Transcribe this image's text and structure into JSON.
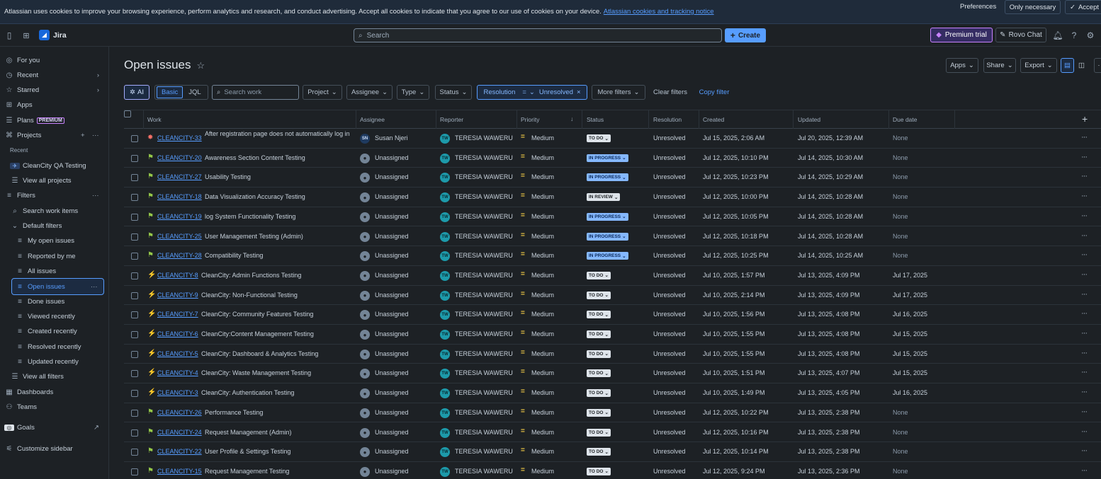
{
  "cookie": {
    "text": "Atlassian uses cookies to improve your browsing experience, perform analytics and research, and conduct advertising. Accept all cookies to indicate that you agree to our use of cookies on your device.",
    "link": "Atlassian cookies and tracking notice",
    "preferences": "Preferences",
    "only_necessary": "Only necessary",
    "accept": "Accept"
  },
  "topnav": {
    "app_name": "Jira",
    "search_placeholder": "Search",
    "create_label": "Create",
    "premium_label": "Premium trial",
    "rovo_label": "Rovo Chat"
  },
  "sidebar": {
    "for_you": "For you",
    "recent": "Recent",
    "starred": "Starred",
    "apps": "Apps",
    "plans": "Plans",
    "plans_badge": "PREMIUM",
    "projects": "Projects",
    "recent_heading": "Recent",
    "project_name": "CleanCity QA Testing",
    "view_all_projects": "View all projects",
    "filters": "Filters",
    "search_work_items": "Search work items",
    "default_filters": "Default filters",
    "filter_items": [
      "My open issues",
      "Reported by me",
      "All issues",
      "Open issues",
      "Done issues",
      "Viewed recently",
      "Created recently",
      "Resolved recently",
      "Updated recently"
    ],
    "view_all_filters": "View all filters",
    "dashboards": "Dashboards",
    "teams": "Teams",
    "goals": "Goals",
    "customize": "Customize sidebar"
  },
  "page": {
    "title": "Open issues",
    "apps": "Apps",
    "share": "Share",
    "export": "Export"
  },
  "filters": {
    "ai": "AI",
    "basic": "Basic",
    "jql": "JQL",
    "search_placeholder": "Search work",
    "project": "Project",
    "assignee": "Assignee",
    "type": "Type",
    "status": "Status",
    "resolution": "Resolution",
    "resolution_op": "=",
    "resolution_value": "Unresolved",
    "more_filters": "More filters",
    "clear_filters": "Clear filters",
    "copy_filter": "Copy filter"
  },
  "columns": [
    "Work",
    "Assignee",
    "Reporter",
    "Priority",
    "Status",
    "Resolution",
    "Created",
    "Updated",
    "Due date"
  ],
  "issues": [
    {
      "type": "bug",
      "key": "CLEANCITY-33",
      "summary": "After registration page does not automatically log in",
      "assignee": "Susan Njeri",
      "assignee_initials": "SN",
      "reporter": "TERESIA WAWERU",
      "reporter_initials": "TW",
      "priority": "Medium",
      "status": "TO DO",
      "resolution": "Unresolved",
      "created": "Jul 15, 2025, 2:06 AM",
      "updated": "Jul 20, 2025, 12:39 AM",
      "due": "None"
    },
    {
      "type": "story",
      "key": "CLEANCITY-20",
      "summary": "Awareness Section Content Testing",
      "assignee": "Unassigned",
      "assignee_initials": "",
      "reporter": "TERESIA WAWERU",
      "reporter_initials": "TW",
      "priority": "Medium",
      "status": "IN PROGRESS",
      "resolution": "Unresolved",
      "created": "Jul 12, 2025, 10:10 PM",
      "updated": "Jul 14, 2025, 10:30 AM",
      "due": "None"
    },
    {
      "type": "story",
      "key": "CLEANCITY-27",
      "summary": "Usability Testing",
      "assignee": "Unassigned",
      "assignee_initials": "",
      "reporter": "TERESIA WAWERU",
      "reporter_initials": "TW",
      "priority": "Medium",
      "status": "IN PROGRESS",
      "resolution": "Unresolved",
      "created": "Jul 12, 2025, 10:23 PM",
      "updated": "Jul 14, 2025, 10:29 AM",
      "due": "None"
    },
    {
      "type": "story",
      "key": "CLEANCITY-18",
      "summary": "Data Visualization Accuracy Testing",
      "assignee": "Unassigned",
      "assignee_initials": "",
      "reporter": "TERESIA WAWERU",
      "reporter_initials": "TW",
      "priority": "Medium",
      "status": "IN REVIEW",
      "resolution": "Unresolved",
      "created": "Jul 12, 2025, 10:00 PM",
      "updated": "Jul 14, 2025, 10:28 AM",
      "due": "None"
    },
    {
      "type": "story",
      "key": "CLEANCITY-19",
      "summary": "log System Functionality Testing",
      "assignee": "Unassigned",
      "assignee_initials": "",
      "reporter": "TERESIA WAWERU",
      "reporter_initials": "TW",
      "priority": "Medium",
      "status": "IN PROGRESS",
      "resolution": "Unresolved",
      "created": "Jul 12, 2025, 10:05 PM",
      "updated": "Jul 14, 2025, 10:28 AM",
      "due": "None"
    },
    {
      "type": "story",
      "key": "CLEANCITY-25",
      "summary": "User Management Testing (Admin)",
      "assignee": "Unassigned",
      "assignee_initials": "",
      "reporter": "TERESIA WAWERU",
      "reporter_initials": "TW",
      "priority": "Medium",
      "status": "IN PROGRESS",
      "resolution": "Unresolved",
      "created": "Jul 12, 2025, 10:18 PM",
      "updated": "Jul 14, 2025, 10:28 AM",
      "due": "None"
    },
    {
      "type": "story",
      "key": "CLEANCITY-28",
      "summary": "Compatibility Testing",
      "assignee": "Unassigned",
      "assignee_initials": "",
      "reporter": "TERESIA WAWERU",
      "reporter_initials": "TW",
      "priority": "Medium",
      "status": "IN PROGRESS",
      "resolution": "Unresolved",
      "created": "Jul 12, 2025, 10:25 PM",
      "updated": "Jul 14, 2025, 10:25 AM",
      "due": "None"
    },
    {
      "type": "epic",
      "key": "CLEANCITY-8",
      "summary": "CleanCity: Admin Functions Testing",
      "assignee": "Unassigned",
      "assignee_initials": "",
      "reporter": "TERESIA WAWERU",
      "reporter_initials": "TW",
      "priority": "Medium",
      "status": "TO DO",
      "resolution": "Unresolved",
      "created": "Jul 10, 2025, 1:57 PM",
      "updated": "Jul 13, 2025, 4:09 PM",
      "due": "Jul 17, 2025"
    },
    {
      "type": "epic",
      "key": "CLEANCITY-9",
      "summary": "CleanCity: Non-Functional Testing",
      "assignee": "Unassigned",
      "assignee_initials": "",
      "reporter": "TERESIA WAWERU",
      "reporter_initials": "TW",
      "priority": "Medium",
      "status": "TO DO",
      "resolution": "Unresolved",
      "created": "Jul 10, 2025, 2:14 PM",
      "updated": "Jul 13, 2025, 4:09 PM",
      "due": "Jul 17, 2025"
    },
    {
      "type": "epic",
      "key": "CLEANCITY-7",
      "summary": "CleanCity: Community Features Testing",
      "assignee": "Unassigned",
      "assignee_initials": "",
      "reporter": "TERESIA WAWERU",
      "reporter_initials": "TW",
      "priority": "Medium",
      "status": "TO DO",
      "resolution": "Unresolved",
      "created": "Jul 10, 2025, 1:56 PM",
      "updated": "Jul 13, 2025, 4:08 PM",
      "due": "Jul 16, 2025"
    },
    {
      "type": "epic",
      "key": "CLEANCITY-6",
      "summary": "CleanCity:Content Management Testing",
      "assignee": "Unassigned",
      "assignee_initials": "",
      "reporter": "TERESIA WAWERU",
      "reporter_initials": "TW",
      "priority": "Medium",
      "status": "TO DO",
      "resolution": "Unresolved",
      "created": "Jul 10, 2025, 1:55 PM",
      "updated": "Jul 13, 2025, 4:08 PM",
      "due": "Jul 15, 2025"
    },
    {
      "type": "epic",
      "key": "CLEANCITY-5",
      "summary": "CleanCity: Dashboard & Analytics Testing",
      "assignee": "Unassigned",
      "assignee_initials": "",
      "reporter": "TERESIA WAWERU",
      "reporter_initials": "TW",
      "priority": "Medium",
      "status": "TO DO",
      "resolution": "Unresolved",
      "created": "Jul 10, 2025, 1:55 PM",
      "updated": "Jul 13, 2025, 4:08 PM",
      "due": "Jul 15, 2025"
    },
    {
      "type": "epic",
      "key": "CLEANCITY-4",
      "summary": "CleanCity: Waste Management Testing",
      "assignee": "Unassigned",
      "assignee_initials": "",
      "reporter": "TERESIA WAWERU",
      "reporter_initials": "TW",
      "priority": "Medium",
      "status": "TO DO",
      "resolution": "Unresolved",
      "created": "Jul 10, 2025, 1:51 PM",
      "updated": "Jul 13, 2025, 4:07 PM",
      "due": "Jul 15, 2025"
    },
    {
      "type": "epic",
      "key": "CLEANCITY-3",
      "summary": "CleanCity: Authentication Testing",
      "assignee": "Unassigned",
      "assignee_initials": "",
      "reporter": "TERESIA WAWERU",
      "reporter_initials": "TW",
      "priority": "Medium",
      "status": "TO DO",
      "resolution": "Unresolved",
      "created": "Jul 10, 2025, 1:49 PM",
      "updated": "Jul 13, 2025, 4:05 PM",
      "due": "Jul 16, 2025"
    },
    {
      "type": "story",
      "key": "CLEANCITY-26",
      "summary": "Performance Testing",
      "assignee": "Unassigned",
      "assignee_initials": "",
      "reporter": "TERESIA WAWERU",
      "reporter_initials": "TW",
      "priority": "Medium",
      "status": "TO DO",
      "resolution": "Unresolved",
      "created": "Jul 12, 2025, 10:22 PM",
      "updated": "Jul 13, 2025, 2:38 PM",
      "due": "None"
    },
    {
      "type": "story",
      "key": "CLEANCITY-24",
      "summary": "Request Management (Admin)",
      "assignee": "Unassigned",
      "assignee_initials": "",
      "reporter": "TERESIA WAWERU",
      "reporter_initials": "TW",
      "priority": "Medium",
      "status": "TO DO",
      "resolution": "Unresolved",
      "created": "Jul 12, 2025, 10:16 PM",
      "updated": "Jul 13, 2025, 2:38 PM",
      "due": "None"
    },
    {
      "type": "story",
      "key": "CLEANCITY-22",
      "summary": "User Profile & Settings Testing",
      "assignee": "Unassigned",
      "assignee_initials": "",
      "reporter": "TERESIA WAWERU",
      "reporter_initials": "TW",
      "priority": "Medium",
      "status": "TO DO",
      "resolution": "Unresolved",
      "created": "Jul 12, 2025, 10:14 PM",
      "updated": "Jul 13, 2025, 2:38 PM",
      "due": "None"
    },
    {
      "type": "story",
      "key": "CLEANCITY-15",
      "summary": "Request Management Testing",
      "assignee": "Unassigned",
      "assignee_initials": "",
      "reporter": "TERESIA WAWERU",
      "reporter_initials": "TW",
      "priority": "Medium",
      "status": "TO DO",
      "resolution": "Unresolved",
      "created": "Jul 12, 2025, 9:24 PM",
      "updated": "Jul 13, 2025, 2:36 PM",
      "due": "None"
    }
  ]
}
